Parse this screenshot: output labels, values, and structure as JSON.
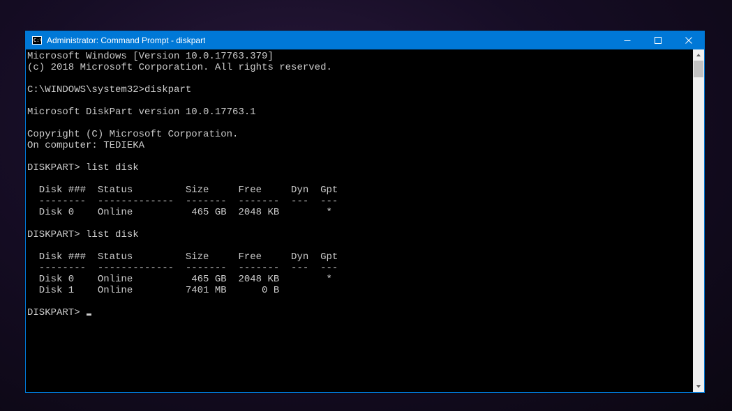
{
  "window": {
    "title": "Administrator: Command Prompt - diskpart",
    "accent_color": "#0078d7",
    "bg_color": "#000000",
    "fg_color": "#cccccc"
  },
  "terminal": {
    "header": {
      "version_line": "Microsoft Windows [Version 10.0.17763.379]",
      "copyright_line": "(c) 2018 Microsoft Corporation. All rights reserved."
    },
    "prompt1": {
      "prefix": "C:\\WINDOWS\\system32>",
      "cmd": "diskpart"
    },
    "diskpart_banner": {
      "version": "Microsoft DiskPart version 10.0.17763.1",
      "copyright": "Copyright (C) Microsoft Corporation.",
      "computer": "On computer: TEDIEKA"
    },
    "sessions": [
      {
        "prompt_prefix": "DISKPART>",
        "cmd": "list disk",
        "table": {
          "header": "  Disk ###  Status         Size     Free     Dyn  Gpt",
          "divider": "  --------  -------------  -------  -------  ---  ---",
          "rows": [
            "  Disk 0    Online          465 GB  2048 KB        *"
          ]
        },
        "disks": [
          {
            "id": "Disk 0",
            "status": "Online",
            "size": "465 GB",
            "free": "2048 KB",
            "dyn": "",
            "gpt": "*"
          }
        ]
      },
      {
        "prompt_prefix": "DISKPART>",
        "cmd": "list disk",
        "table": {
          "header": "  Disk ###  Status         Size     Free     Dyn  Gpt",
          "divider": "  --------  -------------  -------  -------  ---  ---",
          "rows": [
            "  Disk 0    Online          465 GB  2048 KB        *",
            "  Disk 1    Online         7401 MB      0 B"
          ]
        },
        "disks": [
          {
            "id": "Disk 0",
            "status": "Online",
            "size": "465 GB",
            "free": "2048 KB",
            "dyn": "",
            "gpt": "*"
          },
          {
            "id": "Disk 1",
            "status": "Online",
            "size": "7401 MB",
            "free": "0 B",
            "dyn": "",
            "gpt": ""
          }
        ]
      }
    ],
    "current_prompt": "DISKPART>"
  }
}
